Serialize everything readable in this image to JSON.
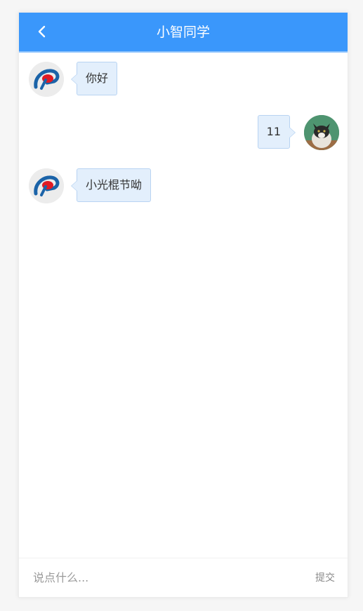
{
  "header": {
    "title": "小智同学",
    "color": "#3a97fb"
  },
  "messages": [
    {
      "side": "left",
      "avatar": "robot-logo-avatar",
      "text": "你好"
    },
    {
      "side": "right",
      "avatar": "cat-photo-avatar",
      "text": "11"
    },
    {
      "side": "left",
      "avatar": "robot-logo-avatar",
      "text": "小光棍节呦"
    }
  ],
  "footer": {
    "input_placeholder": "说点什么...",
    "input_value": "",
    "submit_label": "提交"
  }
}
